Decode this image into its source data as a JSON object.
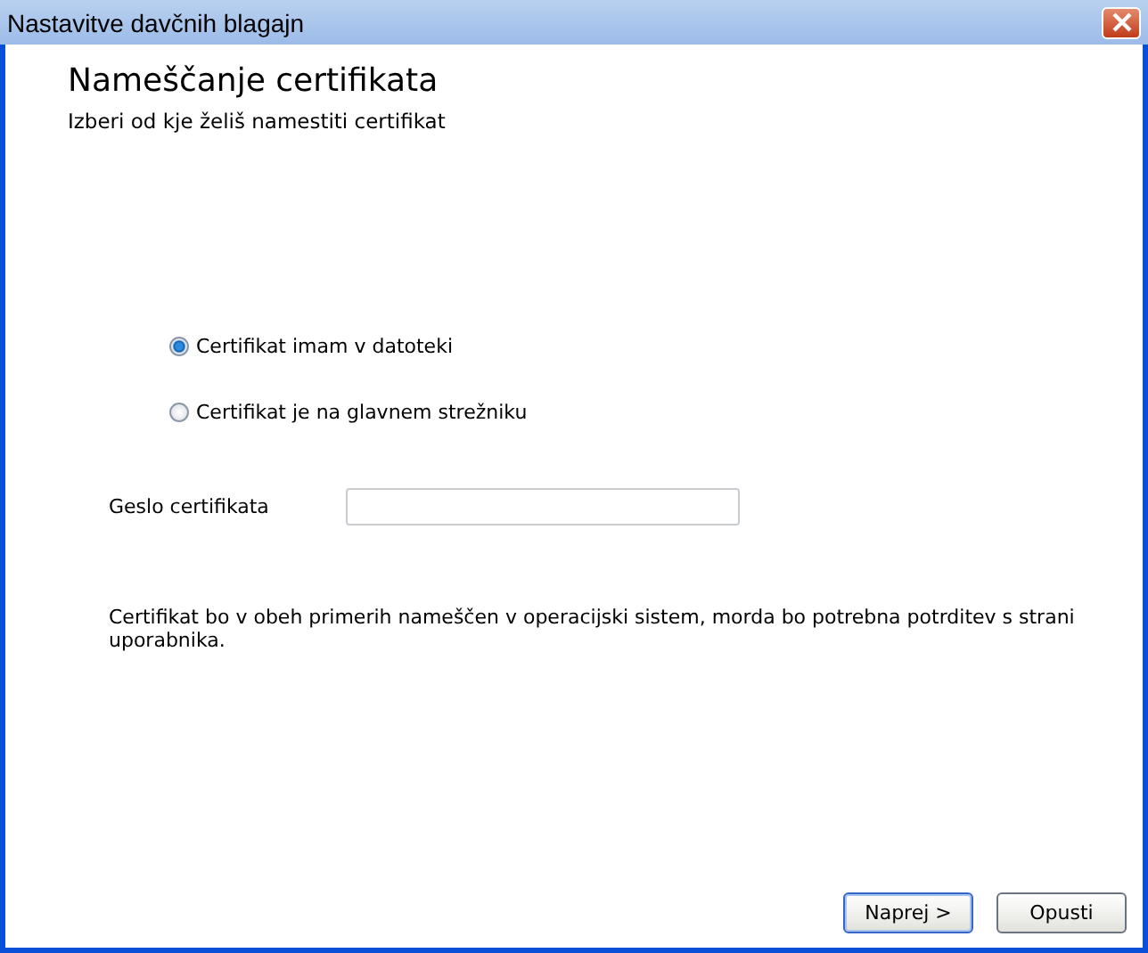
{
  "window": {
    "title": "Nastavitve davčnih blagajn"
  },
  "header": {
    "title": "Nameščanje certifikata",
    "subtitle": "Izberi od kje želiš namestiti certifikat"
  },
  "options": [
    {
      "label": "Certifikat imam v datoteki",
      "selected": true
    },
    {
      "label": "Certifikat je na glavnem strežniku",
      "selected": false
    }
  ],
  "password": {
    "label": "Geslo certifikata"
  },
  "note": "Certifikat bo v obeh primerih nameščen v operacijski sistem, morda bo potrebna potrditev s strani uporabnika.",
  "buttons": [
    {
      "label": "Naprej >",
      "default": true
    },
    {
      "label": "Opusti",
      "default": false
    }
  ]
}
